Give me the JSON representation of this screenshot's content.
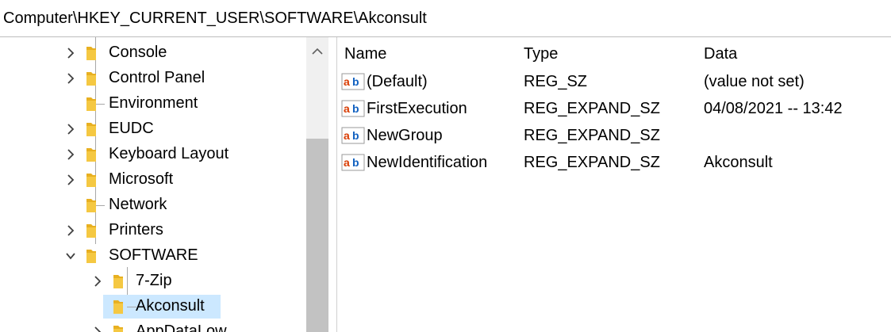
{
  "address": {
    "path": "Computer\\HKEY_CURRENT_USER\\SOFTWARE\\Akconsult"
  },
  "tree": {
    "items": [
      {
        "label": "Console",
        "expander": "collapsed",
        "level": 1
      },
      {
        "label": "Control Panel",
        "expander": "collapsed",
        "level": 1
      },
      {
        "label": "Environment",
        "expander": "none",
        "level": 1
      },
      {
        "label": "EUDC",
        "expander": "collapsed",
        "level": 1
      },
      {
        "label": "Keyboard Layout",
        "expander": "collapsed",
        "level": 1
      },
      {
        "label": "Microsoft",
        "expander": "collapsed",
        "level": 1
      },
      {
        "label": "Network",
        "expander": "none",
        "level": 1
      },
      {
        "label": "Printers",
        "expander": "collapsed",
        "level": 1
      },
      {
        "label": "SOFTWARE",
        "expander": "expanded",
        "level": 1
      },
      {
        "label": "7-Zip",
        "expander": "collapsed",
        "level": 2
      },
      {
        "label": "Akconsult",
        "expander": "none",
        "level": 2,
        "selected": true
      },
      {
        "label": "AppDataLow",
        "expander": "collapsed",
        "level": 2
      }
    ]
  },
  "values_list": {
    "headers": {
      "name": "Name",
      "type": "Type",
      "data": "Data"
    },
    "rows": [
      {
        "name": "(Default)",
        "type": "REG_SZ",
        "data": "(value not set)",
        "icon": "string-value-icon"
      },
      {
        "name": "FirstExecution",
        "type": "REG_EXPAND_SZ",
        "data": "04/08/2021 -- 13:42",
        "icon": "string-value-icon"
      },
      {
        "name": "NewGroup",
        "type": "REG_EXPAND_SZ",
        "data": "",
        "icon": "string-value-icon"
      },
      {
        "name": "NewIdentification",
        "type": "REG_EXPAND_SZ",
        "data": "Akconsult",
        "icon": "string-value-icon"
      }
    ]
  },
  "colors": {
    "folder": "#e8b021",
    "selection": "#cce8ff",
    "icon_red": "#d83b01",
    "icon_blue": "#1060c0"
  }
}
